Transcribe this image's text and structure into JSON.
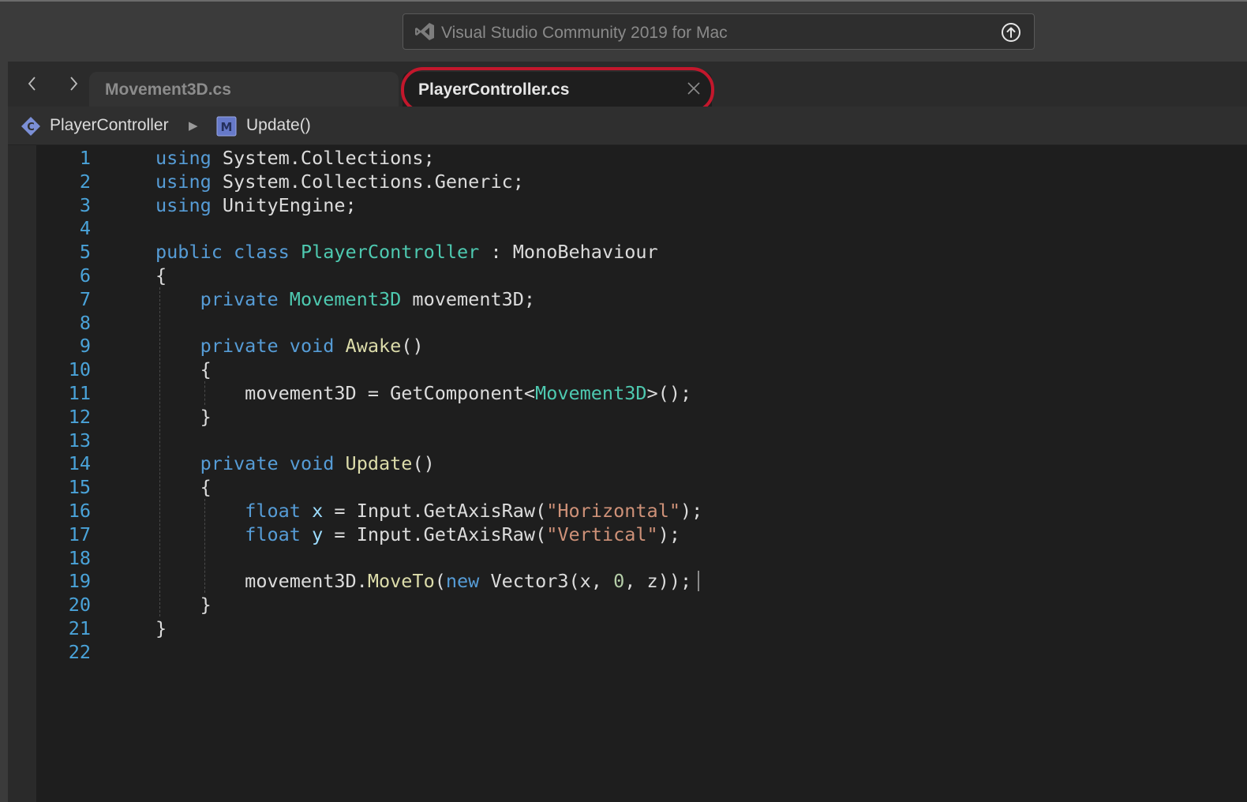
{
  "window": {
    "title": "Visual Studio Community 2019 for Mac",
    "icons": {
      "logo": "visual-studio-icon",
      "action": "upload-icon"
    }
  },
  "tabs": [
    {
      "label": "Movement3D.cs",
      "active": false
    },
    {
      "label": "PlayerController.cs",
      "active": true,
      "highlighted": true
    }
  ],
  "tab_nav": {
    "back": "chevron-left-icon",
    "forward": "chevron-right-icon",
    "close": "close-icon"
  },
  "breadcrumb": {
    "class_name": "PlayerController",
    "separator": "▶",
    "method_name": "Update()"
  },
  "code": {
    "language": "C#",
    "lines": [
      "using System.Collections;",
      "using System.Collections.Generic;",
      "using UnityEngine;",
      "",
      "public class PlayerController : MonoBehaviour",
      "{",
      "    private Movement3D movement3D;",
      "",
      "    private void Awake()",
      "    {",
      "        movement3D = GetComponent<Movement3D>();",
      "    }",
      "",
      "    private void Update()",
      "    {",
      "        float x = Input.GetAxisRaw(\"Horizontal\");",
      "        float y = Input.GetAxisRaw(\"Vertical\");",
      "",
      "        movement3D.MoveTo(new Vector3(x, 0, z));",
      "    }",
      "}",
      ""
    ],
    "caret_line": 19
  },
  "colors": {
    "keyword": "#569cd6",
    "type": "#4ec9b0",
    "method": "#dcdcaa",
    "string": "#ce9178",
    "number": "#b5cea8",
    "line_number": "#4aa3d9",
    "highlight_ring": "#c3172c"
  }
}
